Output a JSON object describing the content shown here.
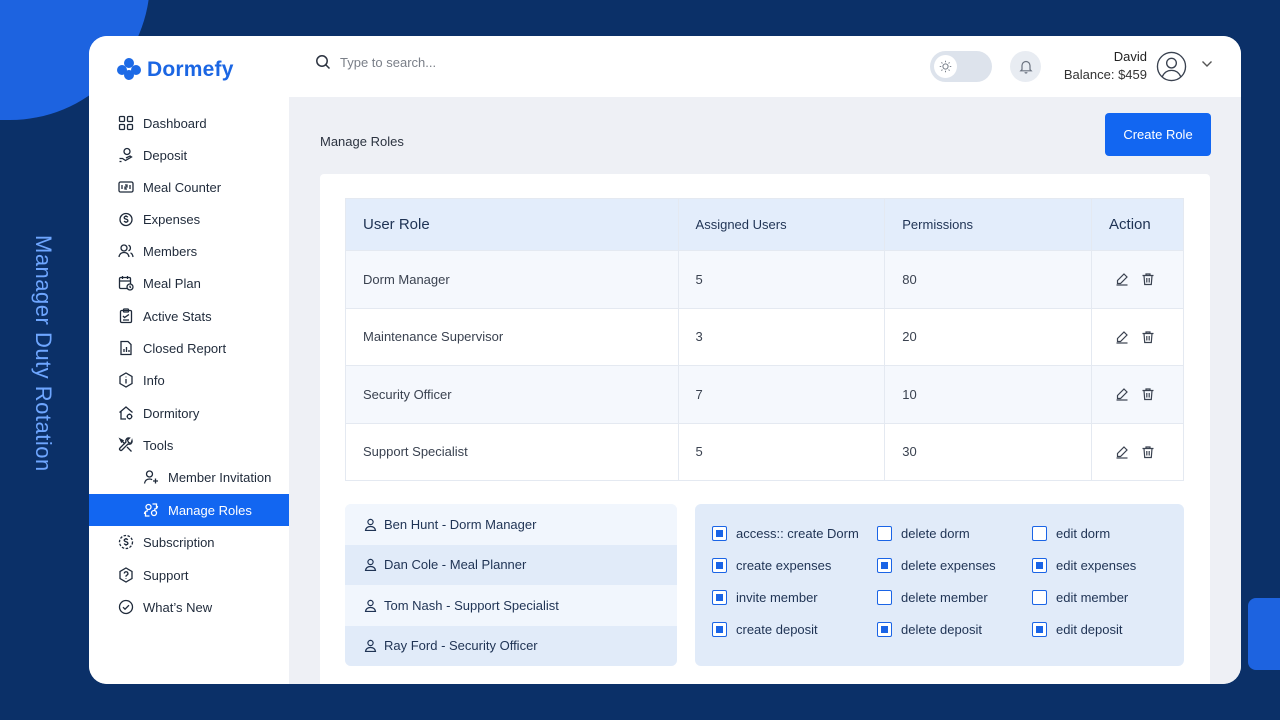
{
  "caption": "Manager Duty Rotation",
  "app": {
    "name": "Dormefy"
  },
  "search": {
    "placeholder": "Type to search..."
  },
  "user": {
    "name": "David",
    "balance": "Balance: $459"
  },
  "sidebar": {
    "items": [
      {
        "label": "Dashboard",
        "icon": "grid-icon"
      },
      {
        "label": "Deposit",
        "icon": "deposit-icon"
      },
      {
        "label": "Meal Counter",
        "icon": "counter-icon"
      },
      {
        "label": "Expenses",
        "icon": "expenses-icon"
      },
      {
        "label": "Members",
        "icon": "members-icon"
      },
      {
        "label": "Meal Plan",
        "icon": "calendar-icon"
      },
      {
        "label": "Active Stats",
        "icon": "clipboard-icon"
      },
      {
        "label": "Closed Report",
        "icon": "report-icon"
      },
      {
        "label": "Info",
        "icon": "info-icon"
      },
      {
        "label": "Dormitory",
        "icon": "home-icon"
      },
      {
        "label": "Tools",
        "icon": "tools-icon"
      },
      {
        "label": "Member Invitation",
        "icon": "user-plus-icon"
      },
      {
        "label": "Manage Roles",
        "icon": "roles-icon"
      },
      {
        "label": "Subscription",
        "icon": "dollar-icon"
      },
      {
        "label": "Support",
        "icon": "help-icon"
      },
      {
        "label": "What’s New",
        "icon": "check-circle-icon"
      }
    ],
    "active": "Manage Roles"
  },
  "main": {
    "title": "Manage Roles",
    "create_label": "Create Role",
    "table": {
      "headers": [
        "User Role",
        "Assigned Users",
        "Permissions",
        "Action"
      ],
      "rows": [
        [
          "Dorm Manager",
          "5",
          "80"
        ],
        [
          "Maintenance Supervisor",
          "3",
          "20"
        ],
        [
          "Security Officer",
          "7",
          "10"
        ],
        [
          "Support Specialist",
          "5",
          "30"
        ]
      ]
    },
    "assigned": [
      "Ben Hunt - Dorm Manager",
      "Dan Cole - Meal Planner",
      "Tom Nash - Support Specialist",
      "Ray Ford - Security Officer"
    ],
    "permissions": [
      {
        "label": "access:: create Dorm",
        "checked": true
      },
      {
        "label": "delete dorm",
        "checked": false
      },
      {
        "label": "edit dorm",
        "checked": false
      },
      {
        "label": "create expenses",
        "checked": true
      },
      {
        "label": "delete expenses",
        "checked": true
      },
      {
        "label": "edit expenses",
        "checked": true
      },
      {
        "label": "invite member",
        "checked": true
      },
      {
        "label": "delete member",
        "checked": false
      },
      {
        "label": "edit member",
        "checked": false
      },
      {
        "label": "create deposit",
        "checked": true
      },
      {
        "label": "delete deposit",
        "checked": true
      },
      {
        "label": "edit deposit",
        "checked": true
      }
    ]
  },
  "colors": {
    "accent": "#1266f1",
    "background": "#0b3068",
    "caption": "#6ea6ff"
  }
}
